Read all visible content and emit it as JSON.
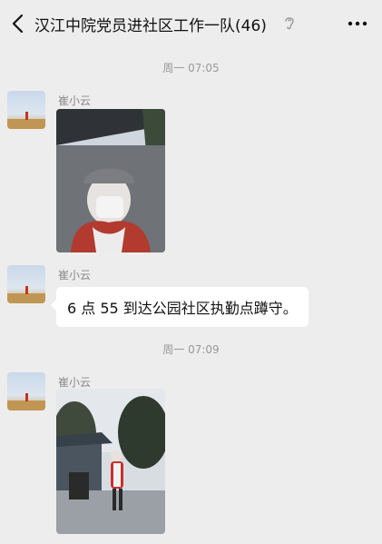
{
  "header": {
    "title": "汉江中院党员进社区工作一队(46)",
    "back_icon": "chevron-left-icon",
    "mute_icon": "ear-icon",
    "more_icon": "more-dots-icon"
  },
  "messages": [
    {
      "type": "time",
      "text": "周一 07:05"
    },
    {
      "type": "image",
      "sender": "崔小云",
      "description": "selfie-with-mask"
    },
    {
      "type": "text",
      "sender": "崔小云",
      "text": "6 点 55 到达公园社区执勤点蹲守。"
    },
    {
      "type": "time",
      "text": "周一 07:09"
    },
    {
      "type": "image",
      "sender": "崔小云",
      "description": "standing-at-checkpoint"
    }
  ],
  "colors": {
    "background": "#ededed",
    "bubble": "#ffffff",
    "time_text": "#999999"
  }
}
